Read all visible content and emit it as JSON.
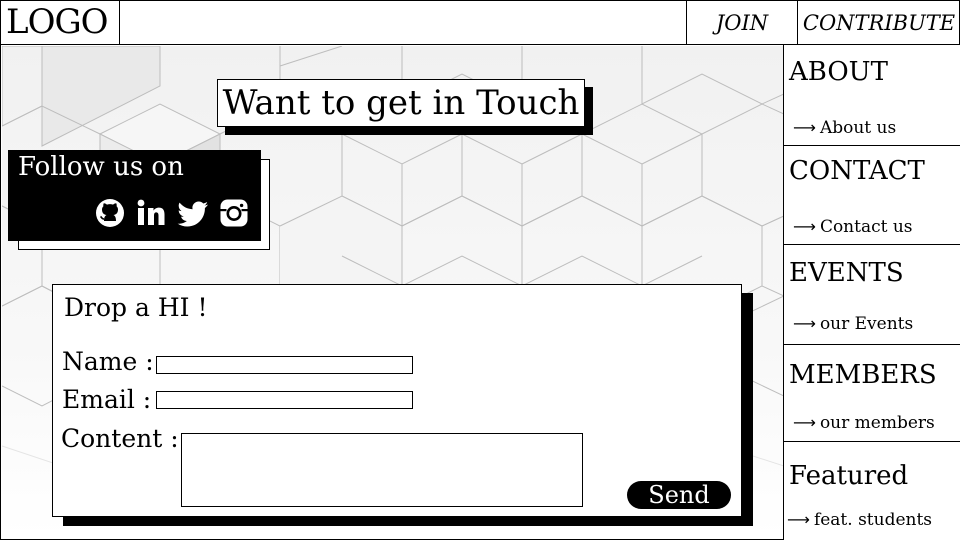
{
  "header": {
    "logo": "LOGO",
    "nav": {
      "join": "JOIN",
      "contribute": "CONTRIBUTE"
    }
  },
  "hero": {
    "title": "Want to get in Touch"
  },
  "follow": {
    "label": "Follow us on",
    "icons": [
      "github-icon",
      "linkedin-icon",
      "twitter-icon",
      "instagram-icon"
    ]
  },
  "form": {
    "heading": "Drop a HI !",
    "name_label": "Name :",
    "email_label": "Email :",
    "content_label": "Content :",
    "name_value": "",
    "email_value": "",
    "content_value": "",
    "send_label": "Send"
  },
  "sidebar": {
    "arrow": "⟶",
    "sections": [
      {
        "title": "ABOUT",
        "link": "About us"
      },
      {
        "title": "CONTACT",
        "link": "Contact us"
      },
      {
        "title": "EVENTS",
        "link": "our Events"
      },
      {
        "title": "MEMBERS",
        "link": "our members"
      },
      {
        "title": "Featured",
        "link": "feat. students"
      }
    ]
  },
  "colors": {
    "ink": "#000000",
    "paper": "#ffffff",
    "bg_pattern": "#f1f1f1"
  }
}
